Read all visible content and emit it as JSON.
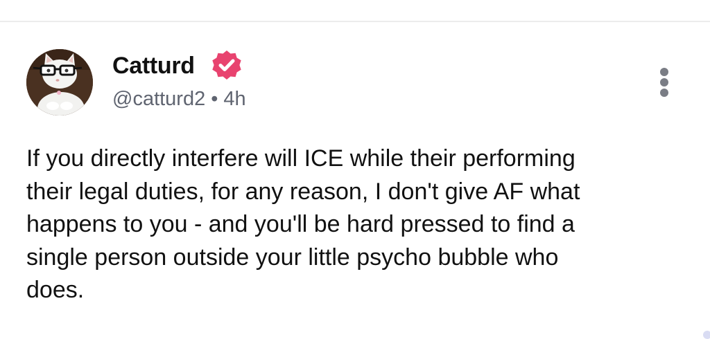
{
  "post": {
    "author": {
      "display_name": "Catturd",
      "handle": "@catturd2",
      "verified": true,
      "avatar_icon": "cat-with-glasses-avatar"
    },
    "timestamp": "4h",
    "separator": "•",
    "text": "If you directly interfere will ICE while their performing\ntheir legal duties, for any reason, I don't give AF what\nhappens to you - and you'll be hard pressed to find a\nsingle person outside your little psycho bubble who\ndoes.",
    "actions": {
      "more_icon": "more-vertical-icon"
    }
  },
  "colors": {
    "verified_badge": "#e8436f",
    "meta_text": "#5f6470",
    "body_text": "#111111",
    "divider": "#ececec"
  }
}
